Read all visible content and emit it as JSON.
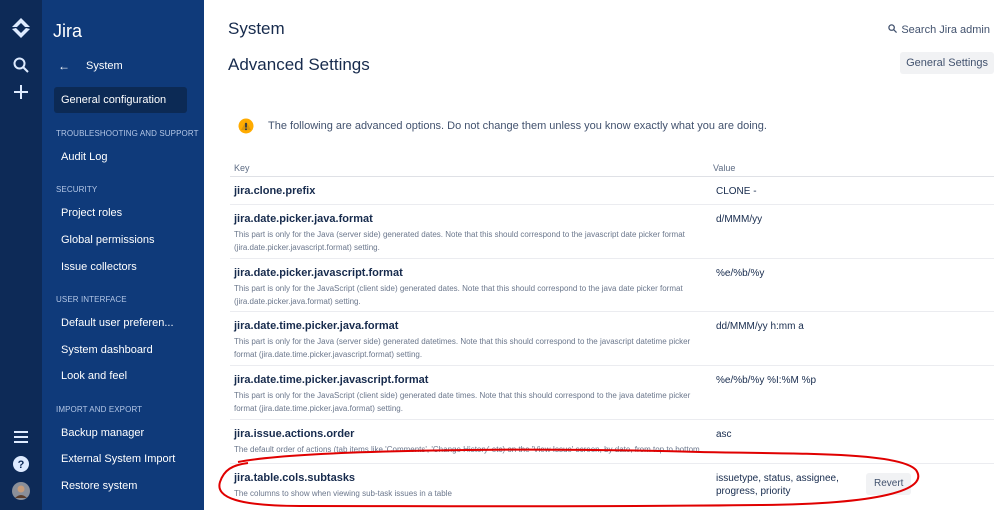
{
  "global_nav": {
    "logo_icon": "jira-logo-icon",
    "search_icon": "search-icon",
    "create_icon": "plus-icon",
    "menu_icon": "hamburger-icon",
    "help_icon": "help-icon",
    "avatar_icon": "avatar"
  },
  "sidebar": {
    "title": "Jira",
    "back_label": "System",
    "active_item": "General configuration",
    "sections": [
      {
        "heading": "TROUBLESHOOTING AND SUPPORT",
        "items": [
          "Audit Log"
        ]
      },
      {
        "heading": "SECURITY",
        "items": [
          "Project roles",
          "Global permissions",
          "Issue collectors"
        ]
      },
      {
        "heading": "USER INTERFACE",
        "items": [
          "Default user preferen...",
          "System dashboard",
          "Look and feel"
        ]
      },
      {
        "heading": "IMPORT AND EXPORT",
        "items": [
          "Backup manager",
          "External System Import",
          "Restore system"
        ]
      }
    ]
  },
  "header": {
    "section_title": "System",
    "page_title": "Advanced Settings",
    "search_link": "Search Jira admin",
    "settings_button": "General Settings"
  },
  "warning": {
    "text": "The following are advanced options. Do not change them unless you know exactly what you are doing."
  },
  "table": {
    "headers": {
      "key": "Key",
      "value": "Value"
    },
    "rows": [
      {
        "key": "jira.clone.prefix",
        "description": "",
        "value": "CLONE -"
      },
      {
        "key": "jira.date.picker.java.format",
        "description": "This part is only for the Java (server side) generated dates. Note that this should correspond to the javascript date picker format (jira.date.picker.javascript.format) setting.",
        "value": "d/MMM/yy"
      },
      {
        "key": "jira.date.picker.javascript.format",
        "description": "This part is only for the JavaScript (client side) generated dates. Note that this should correspond to the java date picker format (jira.date.picker.java.format) setting.",
        "value": "%e/%b/%y"
      },
      {
        "key": "jira.date.time.picker.java.format",
        "description": "This part is only for the Java (server side) generated datetimes. Note that this should correspond to the javascript datetime picker format (jira.date.time.picker.javascript.format) setting.",
        "value": "dd/MMM/yy h:mm a"
      },
      {
        "key": "jira.date.time.picker.javascript.format",
        "description": "This part is only for the JavaScript (client side) generated date times. Note that this should correspond to the java datetime picker format (jira.date.time.picker.java.format) setting.",
        "value": "%e/%b/%y %I:%M %p"
      },
      {
        "key": "jira.issue.actions.order",
        "description": "The default order of actions (tab items like 'Comments', 'Change History' etc) on the 'View Issue' screen, by date, from top to bottom.",
        "value": "asc"
      },
      {
        "key": "jira.table.cols.subtasks",
        "description": "The columns to show when viewing sub-task issues in a table",
        "value": "issuetype, status, assignee, progress, priority",
        "revert_label": "Revert"
      }
    ]
  },
  "colors": {
    "global_nav_bg": "#0d2a57",
    "sidebar_bg": "#0f3a7a",
    "annotation": "#e00000",
    "warning": "#ffab00"
  }
}
